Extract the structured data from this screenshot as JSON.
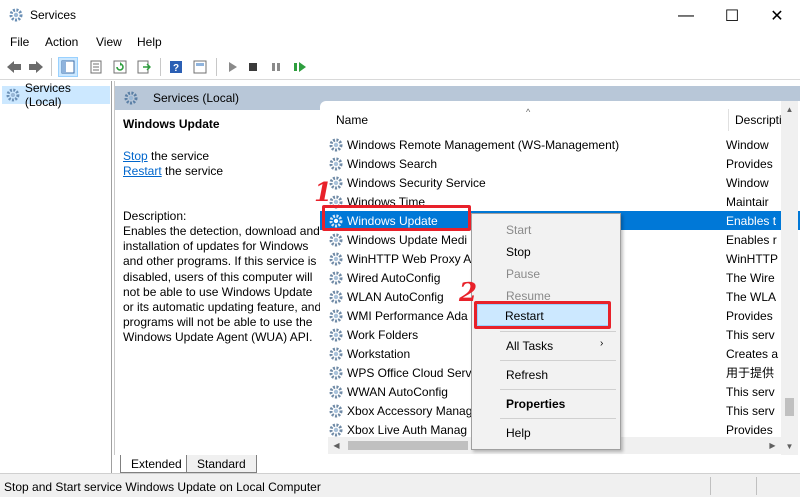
{
  "window": {
    "title": "Services",
    "min": "—",
    "max": "☐",
    "close": "✕"
  },
  "menu": [
    "File",
    "Action",
    "View",
    "Help"
  ],
  "tree": {
    "item": "Services (Local)"
  },
  "pane": {
    "header": "Services (Local)"
  },
  "details": {
    "title": "Windows Update",
    "stop_link": "Stop",
    "stop_rest": " the service",
    "restart_link": "Restart",
    "restart_rest": " the service",
    "desc_label": "Description:",
    "desc_text": "Enables the detection, download and installation of updates for Windows and other programs. If this service is disabled, users of this computer will not be able to use Windows Update or its automatic updating feature, and programs will not be able to use the Windows Update Agent (WUA) API."
  },
  "list": {
    "col_name": "Name",
    "col_desc": "Descripti",
    "sort": "^",
    "rows": [
      {
        "name": "Windows Remote Management (WS-Management)",
        "desc": "Window"
      },
      {
        "name": "Windows Search",
        "desc": "Provides"
      },
      {
        "name": "Windows Security Service",
        "desc": "Window"
      },
      {
        "name": "Windows Time",
        "desc": "Maintair"
      },
      {
        "name": "Windows Update",
        "desc": "Enables t"
      },
      {
        "name": "Windows Update Medi",
        "desc": "Enables r"
      },
      {
        "name": "WinHTTP Web Proxy A",
        "desc": "WinHTTP"
      },
      {
        "name": "Wired AutoConfig",
        "desc": "The Wire"
      },
      {
        "name": "WLAN AutoConfig",
        "desc": "The WLA"
      },
      {
        "name": "WMI Performance Ada",
        "desc": "Provides"
      },
      {
        "name": "Work Folders",
        "desc": "This serv"
      },
      {
        "name": "Workstation",
        "desc": "Creates a"
      },
      {
        "name": "WPS Office Cloud Serv",
        "desc": "用于提供"
      },
      {
        "name": "WWAN AutoConfig",
        "desc": "This serv"
      },
      {
        "name": "Xbox Accessory Manag",
        "desc": "This serv"
      },
      {
        "name": "Xbox Live Auth Manag",
        "desc": "Provides"
      }
    ]
  },
  "context_menu": {
    "start": "Start",
    "stop": "Stop",
    "pause": "Pause",
    "resume": "Resume",
    "restart": "Restart",
    "all_tasks": "All Tasks",
    "refresh": "Refresh",
    "properties": "Properties",
    "help": "Help",
    "submenu_arrow": "›"
  },
  "steps": {
    "one": "1",
    "two": "2"
  },
  "tabs": {
    "extended": "Extended",
    "standard": "Standard"
  },
  "status": {
    "text": "Stop and Start service Windows Update on Local Computer"
  },
  "colors": {
    "selection": "#0078d7",
    "annotation": "#e8212a",
    "link": "#0066cc",
    "header": "#b8c7d8"
  }
}
